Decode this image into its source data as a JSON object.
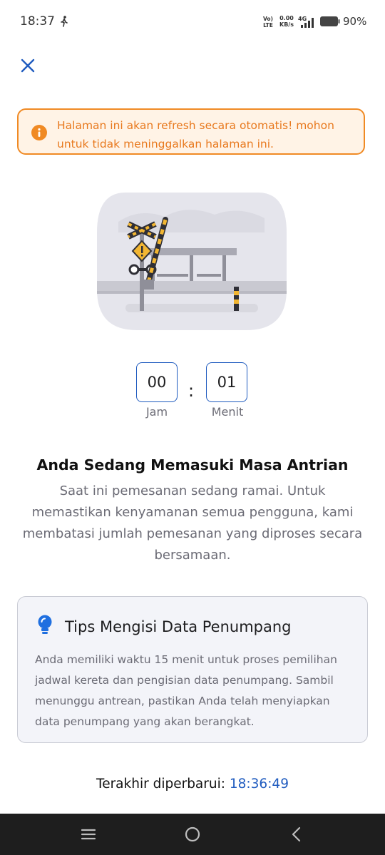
{
  "status_bar": {
    "time": "18:37",
    "volte_top": "Vo)",
    "volte_bottom": "LTE",
    "speed_value": "0.00",
    "speed_unit": "KB/s",
    "network": "4G",
    "battery": "90%"
  },
  "alert": {
    "icon": "info-icon",
    "message": "Halaman ini akan refresh secara otomatis! mohon untuk tidak meninggalkan halaman ini."
  },
  "timer": {
    "hours": "00",
    "minutes": "01",
    "separator": ":",
    "hours_label": "Jam",
    "minutes_label": "Menit"
  },
  "queue": {
    "title": "Anda Sedang Memasuki Masa Antrian",
    "description": "Saat ini pemesanan sedang ramai. Untuk memastikan kenyamanan semua pengguna, kami membatasi jumlah pemesanan yang diproses secara bersamaan."
  },
  "tips": {
    "icon": "lightbulb-icon",
    "title": "Tips Mengisi Data Penumpang",
    "body": "Anda memiliki waktu 15 menit untuk proses pemilihan jadwal kereta dan pengisian data penumpang. Sambil menunggu antrean, pastikan Anda telah menyiapkan data penumpang yang akan berangkat."
  },
  "updated": {
    "label": "Terakhir diperbarui:",
    "time": "18:36:49"
  },
  "colors": {
    "accent_blue": "#1f5bbf",
    "alert_orange": "#f08a24",
    "alert_bg": "#fff3e6",
    "tips_bg": "#f3f4f9"
  }
}
